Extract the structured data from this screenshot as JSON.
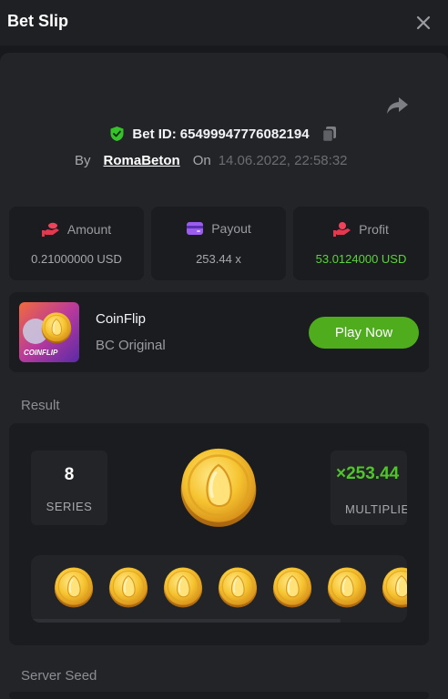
{
  "header": {
    "title": "Bet Slip"
  },
  "bet": {
    "id_label": "Bet ID:",
    "id": "65499947776082194",
    "by_label": "By",
    "user": "RomaBeton",
    "on_label": "On",
    "date": "14.06.2022, 22:58:32"
  },
  "stats": {
    "amount": {
      "label": "Amount",
      "value": "0.21000000 USD"
    },
    "payout": {
      "label": "Payout",
      "value": "253.44 x"
    },
    "profit": {
      "label": "Profit",
      "value": "53.0124000 USD"
    }
  },
  "game": {
    "name": "CoinFlip",
    "provider": "BC Original",
    "thumb_text": "COINFLIP",
    "play_label": "Play Now"
  },
  "result": {
    "section_label": "Result",
    "series_value": "8",
    "series_label": "SERIES",
    "multiplier_value": "×253.44",
    "multiplier_label": "MULTIPLIER"
  },
  "server_seed": {
    "label": "Server Seed"
  },
  "colors": {
    "accent_green": "#4fac1d",
    "profit_green": "#5ad43b",
    "background": "#18191c",
    "card": "#1b1c1f"
  },
  "icons": {
    "close": "close-icon",
    "share": "share-icon",
    "verified": "shield-check-icon",
    "copy": "copy-icon",
    "amount": "coins-hand-icon",
    "payout": "wallet-card-icon",
    "profit": "hand-coin-icon"
  }
}
